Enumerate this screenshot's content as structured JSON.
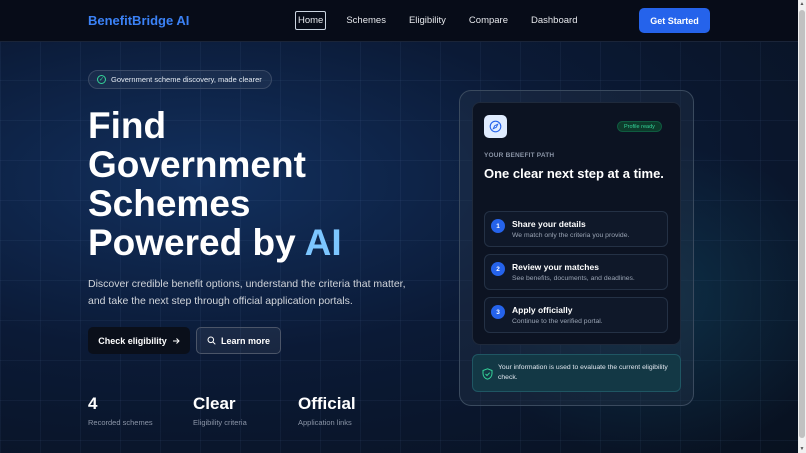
{
  "nav": {
    "brand": "BenefitBridge AI",
    "links": [
      {
        "label": "Home",
        "active": true
      },
      {
        "label": "Schemes"
      },
      {
        "label": "Eligibility"
      },
      {
        "label": "Compare"
      },
      {
        "label": "Dashboard"
      }
    ],
    "cta": "Get Started"
  },
  "hero": {
    "pill": "Government scheme discovery, made clearer",
    "title_line1": "Find",
    "title_line2": "Government",
    "title_line3": "Schemes",
    "title_line4_prefix": "Powered by ",
    "title_line4_accent": "AI",
    "description": "Discover credible benefit options, understand the criteria that matter, and take the next step through official application portals.",
    "primary_button": "Check eligibility",
    "secondary_button": "Learn more",
    "stats": [
      {
        "value": "4",
        "label": "Recorded schemes"
      },
      {
        "value": "Clear",
        "label": "Eligibility criteria"
      },
      {
        "value": "Official",
        "label": "Application links"
      }
    ]
  },
  "card": {
    "badge": "Profile ready",
    "section_label": "YOUR BENEFIT PATH",
    "title": "One clear next step at a time.",
    "steps": [
      {
        "num": "1",
        "title": "Share your details",
        "desc": "We match only the criteria you provide."
      },
      {
        "num": "2",
        "title": "Review your matches",
        "desc": "See benefits, documents, and deadlines."
      },
      {
        "num": "3",
        "title": "Apply officially",
        "desc": "Continue to the verified portal."
      }
    ],
    "notice": "Your information is used to evaluate the current eligibility check."
  },
  "colors": {
    "accent": "#2563eb",
    "brand": "#3b82f6",
    "success": "#34d399"
  }
}
